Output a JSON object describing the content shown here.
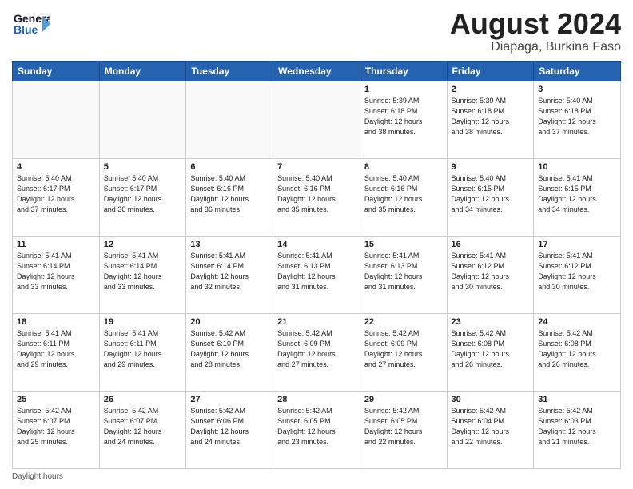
{
  "header": {
    "logo_line1": "General",
    "logo_line2": "Blue",
    "month_title": "August 2024",
    "location": "Diapaga, Burkina Faso"
  },
  "days_of_week": [
    "Sunday",
    "Monday",
    "Tuesday",
    "Wednesday",
    "Thursday",
    "Friday",
    "Saturday"
  ],
  "weeks": [
    [
      {
        "day": "",
        "info": ""
      },
      {
        "day": "",
        "info": ""
      },
      {
        "day": "",
        "info": ""
      },
      {
        "day": "",
        "info": ""
      },
      {
        "day": "1",
        "info": "Sunrise: 5:39 AM\nSunset: 6:18 PM\nDaylight: 12 hours\nand 38 minutes."
      },
      {
        "day": "2",
        "info": "Sunrise: 5:39 AM\nSunset: 6:18 PM\nDaylight: 12 hours\nand 38 minutes."
      },
      {
        "day": "3",
        "info": "Sunrise: 5:40 AM\nSunset: 6:18 PM\nDaylight: 12 hours\nand 37 minutes."
      }
    ],
    [
      {
        "day": "4",
        "info": "Sunrise: 5:40 AM\nSunset: 6:17 PM\nDaylight: 12 hours\nand 37 minutes."
      },
      {
        "day": "5",
        "info": "Sunrise: 5:40 AM\nSunset: 6:17 PM\nDaylight: 12 hours\nand 36 minutes."
      },
      {
        "day": "6",
        "info": "Sunrise: 5:40 AM\nSunset: 6:16 PM\nDaylight: 12 hours\nand 36 minutes."
      },
      {
        "day": "7",
        "info": "Sunrise: 5:40 AM\nSunset: 6:16 PM\nDaylight: 12 hours\nand 35 minutes."
      },
      {
        "day": "8",
        "info": "Sunrise: 5:40 AM\nSunset: 6:16 PM\nDaylight: 12 hours\nand 35 minutes."
      },
      {
        "day": "9",
        "info": "Sunrise: 5:40 AM\nSunset: 6:15 PM\nDaylight: 12 hours\nand 34 minutes."
      },
      {
        "day": "10",
        "info": "Sunrise: 5:41 AM\nSunset: 6:15 PM\nDaylight: 12 hours\nand 34 minutes."
      }
    ],
    [
      {
        "day": "11",
        "info": "Sunrise: 5:41 AM\nSunset: 6:14 PM\nDaylight: 12 hours\nand 33 minutes."
      },
      {
        "day": "12",
        "info": "Sunrise: 5:41 AM\nSunset: 6:14 PM\nDaylight: 12 hours\nand 33 minutes."
      },
      {
        "day": "13",
        "info": "Sunrise: 5:41 AM\nSunset: 6:14 PM\nDaylight: 12 hours\nand 32 minutes."
      },
      {
        "day": "14",
        "info": "Sunrise: 5:41 AM\nSunset: 6:13 PM\nDaylight: 12 hours\nand 31 minutes."
      },
      {
        "day": "15",
        "info": "Sunrise: 5:41 AM\nSunset: 6:13 PM\nDaylight: 12 hours\nand 31 minutes."
      },
      {
        "day": "16",
        "info": "Sunrise: 5:41 AM\nSunset: 6:12 PM\nDaylight: 12 hours\nand 30 minutes."
      },
      {
        "day": "17",
        "info": "Sunrise: 5:41 AM\nSunset: 6:12 PM\nDaylight: 12 hours\nand 30 minutes."
      }
    ],
    [
      {
        "day": "18",
        "info": "Sunrise: 5:41 AM\nSunset: 6:11 PM\nDaylight: 12 hours\nand 29 minutes."
      },
      {
        "day": "19",
        "info": "Sunrise: 5:41 AM\nSunset: 6:11 PM\nDaylight: 12 hours\nand 29 minutes."
      },
      {
        "day": "20",
        "info": "Sunrise: 5:42 AM\nSunset: 6:10 PM\nDaylight: 12 hours\nand 28 minutes."
      },
      {
        "day": "21",
        "info": "Sunrise: 5:42 AM\nSunset: 6:09 PM\nDaylight: 12 hours\nand 27 minutes."
      },
      {
        "day": "22",
        "info": "Sunrise: 5:42 AM\nSunset: 6:09 PM\nDaylight: 12 hours\nand 27 minutes."
      },
      {
        "day": "23",
        "info": "Sunrise: 5:42 AM\nSunset: 6:08 PM\nDaylight: 12 hours\nand 26 minutes."
      },
      {
        "day": "24",
        "info": "Sunrise: 5:42 AM\nSunset: 6:08 PM\nDaylight: 12 hours\nand 26 minutes."
      }
    ],
    [
      {
        "day": "25",
        "info": "Sunrise: 5:42 AM\nSunset: 6:07 PM\nDaylight: 12 hours\nand 25 minutes."
      },
      {
        "day": "26",
        "info": "Sunrise: 5:42 AM\nSunset: 6:07 PM\nDaylight: 12 hours\nand 24 minutes."
      },
      {
        "day": "27",
        "info": "Sunrise: 5:42 AM\nSunset: 6:06 PM\nDaylight: 12 hours\nand 24 minutes."
      },
      {
        "day": "28",
        "info": "Sunrise: 5:42 AM\nSunset: 6:05 PM\nDaylight: 12 hours\nand 23 minutes."
      },
      {
        "day": "29",
        "info": "Sunrise: 5:42 AM\nSunset: 6:05 PM\nDaylight: 12 hours\nand 22 minutes."
      },
      {
        "day": "30",
        "info": "Sunrise: 5:42 AM\nSunset: 6:04 PM\nDaylight: 12 hours\nand 22 minutes."
      },
      {
        "day": "31",
        "info": "Sunrise: 5:42 AM\nSunset: 6:03 PM\nDaylight: 12 hours\nand 21 minutes."
      }
    ]
  ],
  "footer": {
    "note": "Daylight hours"
  }
}
